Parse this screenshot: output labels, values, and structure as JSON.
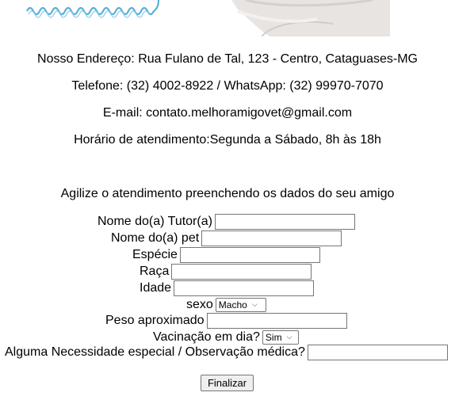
{
  "contact": {
    "address": "Nosso Endereço: Rua Fulano de Tal, 123 - Centro, Cataguases-MG",
    "phone": "Telefone: (32) 4002-8922 / WhatsApp: (32) 99970-7070",
    "email": "E-mail: contato.melhoramigovet@gmail.com",
    "hours": "Horário de atendimento:Segunda a Sábado, 8h às 18h"
  },
  "form": {
    "intro": "Agilize o atendimento preenchendo os dados do seu amigo",
    "tutor_label": "Nome do(a) Tutor(a)",
    "pet_label": "Nome do(a) pet",
    "species_label": "Espécie",
    "breed_label": "Raça",
    "age_label": "Idade",
    "sex_label": "sexo",
    "sex_value": "Macho",
    "weight_label": "Peso aproximado",
    "vaccine_label": "Vacinação em dia?",
    "vaccine_value": "Sim",
    "notes_label": "Alguma Necessidade especial / Observação médica?",
    "submit_label": "Finalizar"
  },
  "icons": {
    "chevron": "chevron-down-icon"
  }
}
